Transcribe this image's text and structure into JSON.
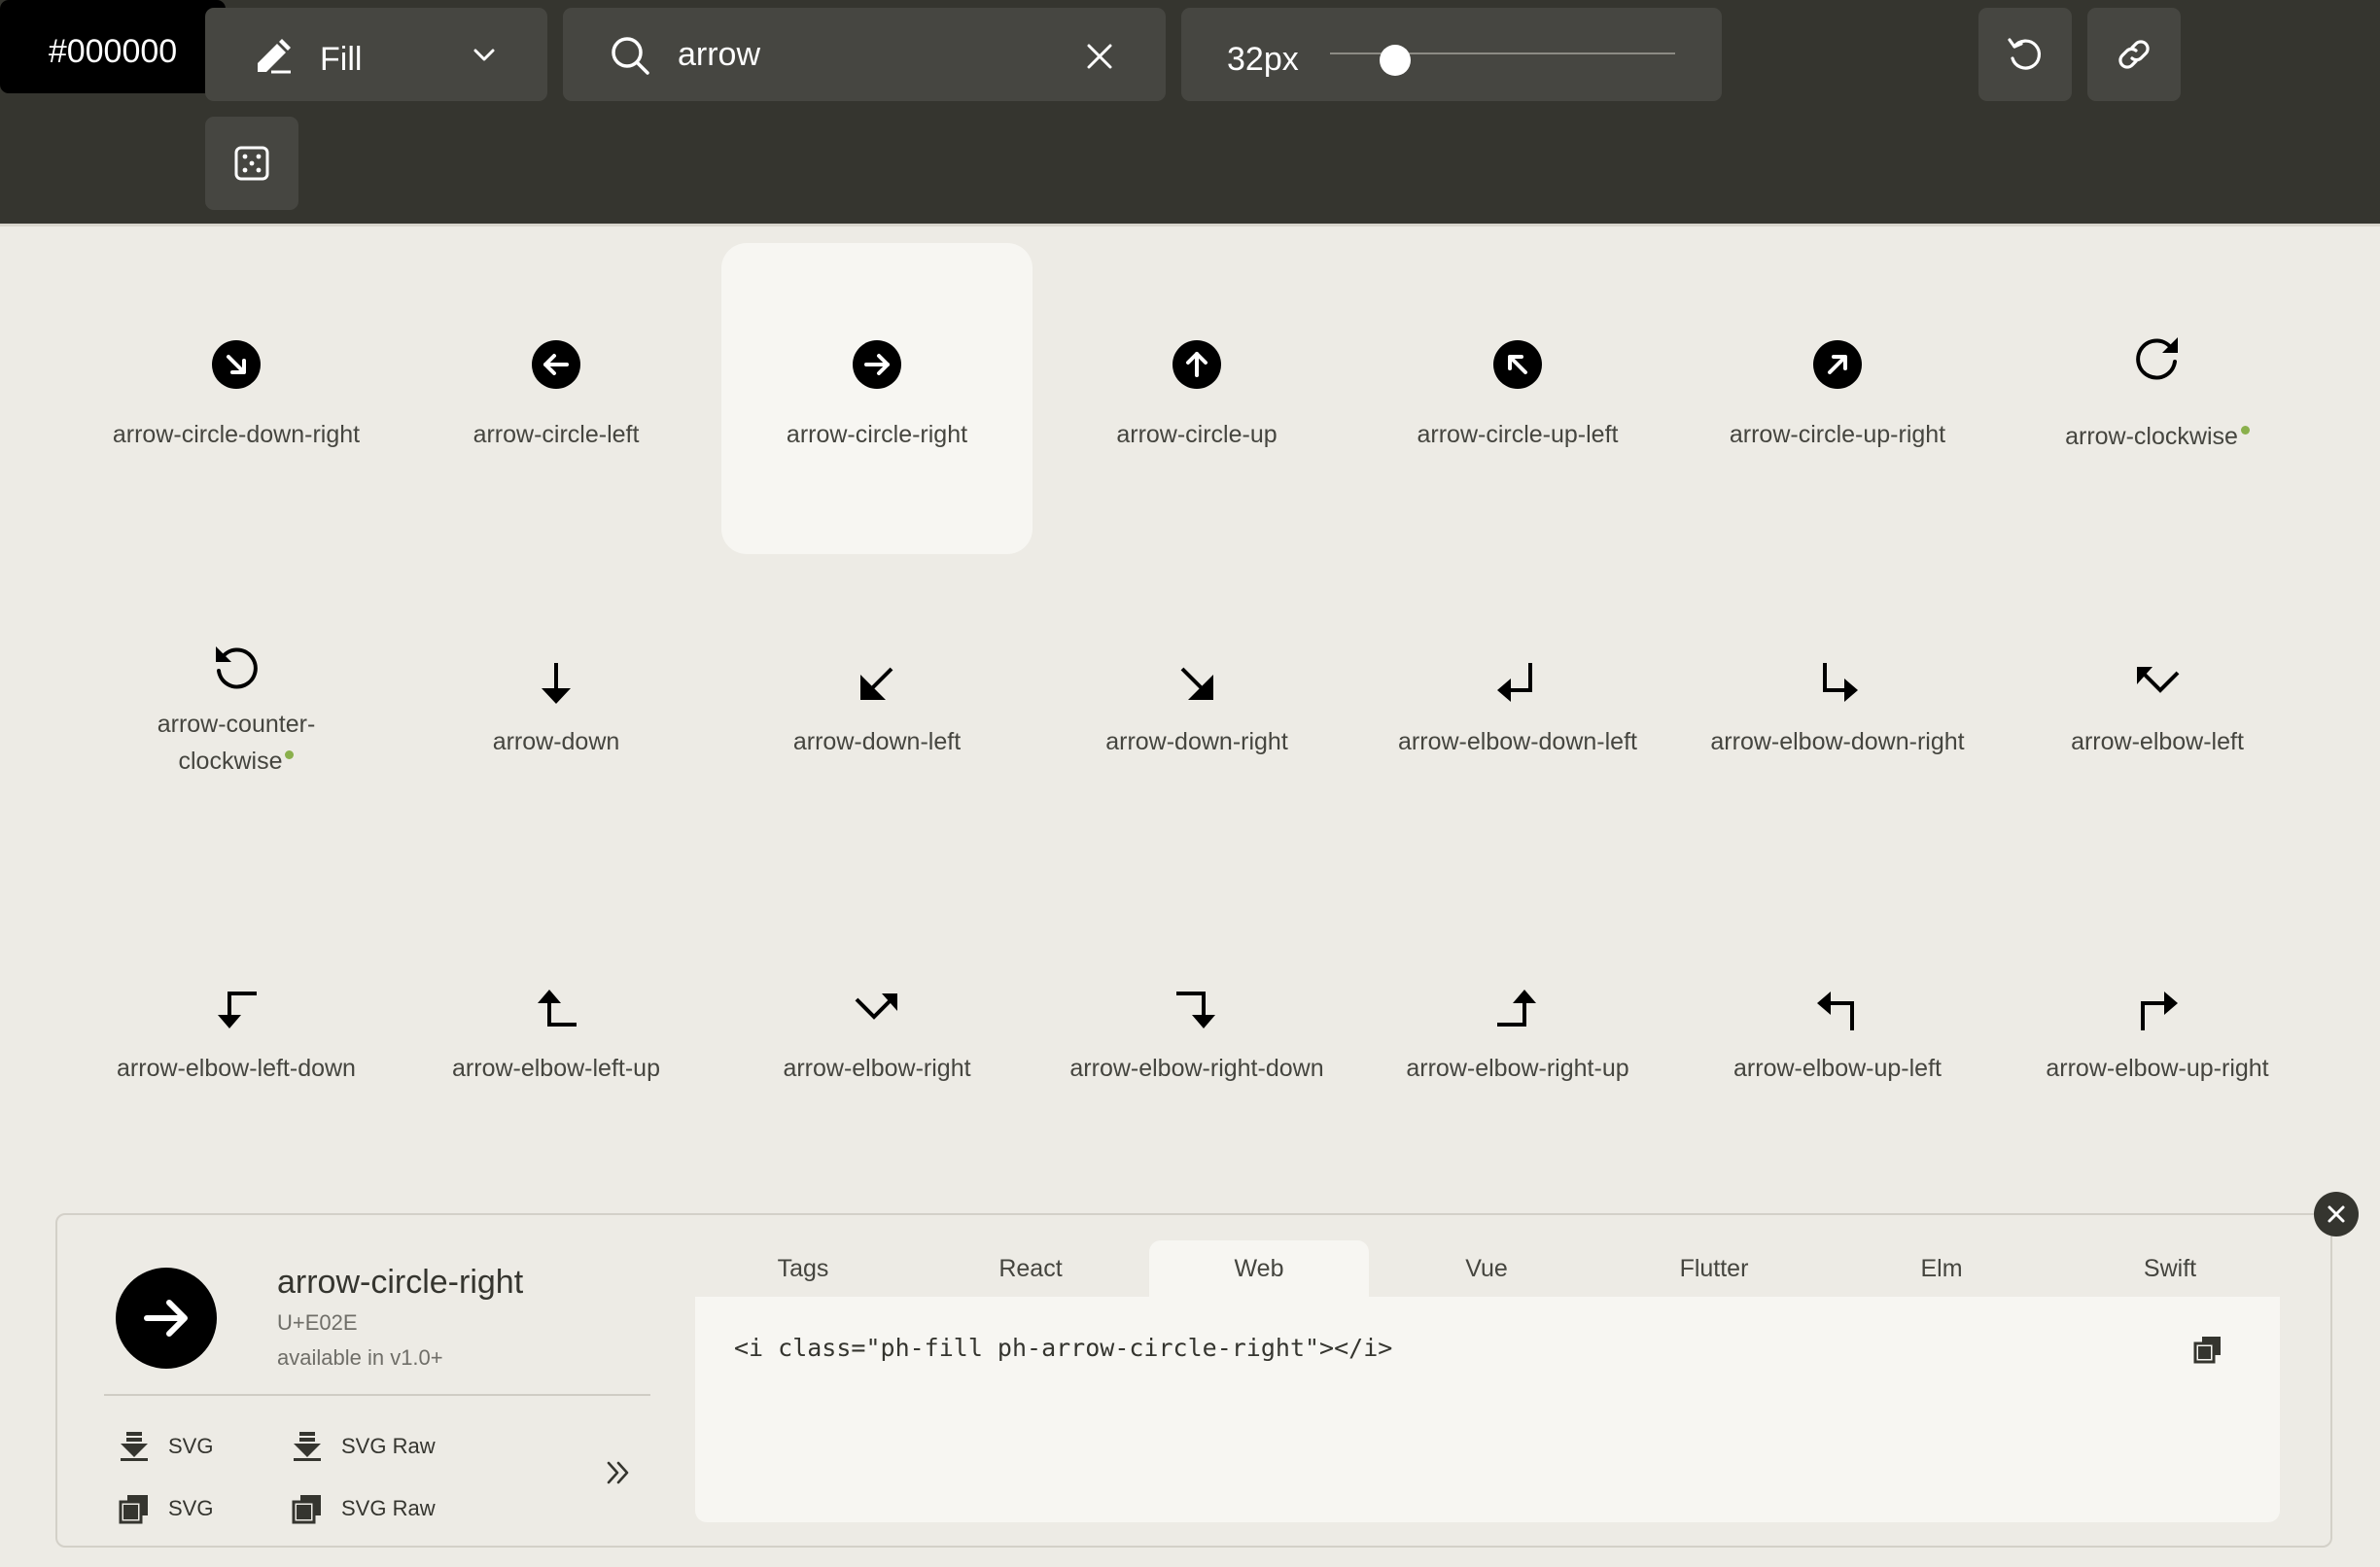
{
  "toolbar": {
    "weight_label": "Fill",
    "search_value": "arrow",
    "size_label": "32px",
    "size_slider": {
      "min": 16,
      "max": 96,
      "value": 32
    },
    "color_label": "#000000"
  },
  "icons": [
    {
      "name": "arrow-circle-down-right",
      "new": false
    },
    {
      "name": "arrow-circle-left",
      "new": false
    },
    {
      "name": "arrow-circle-right",
      "new": false,
      "selected": true
    },
    {
      "name": "arrow-circle-up",
      "new": false
    },
    {
      "name": "arrow-circle-up-left",
      "new": false
    },
    {
      "name": "arrow-circle-up-right",
      "new": false
    },
    {
      "name": "arrow-clockwise",
      "new": true
    },
    {
      "name": "arrow-counter-clockwise",
      "new": true
    },
    {
      "name": "arrow-down",
      "new": false
    },
    {
      "name": "arrow-down-left",
      "new": false
    },
    {
      "name": "arrow-down-right",
      "new": false
    },
    {
      "name": "arrow-elbow-down-left",
      "new": false
    },
    {
      "name": "arrow-elbow-down-right",
      "new": false
    },
    {
      "name": "arrow-elbow-left",
      "new": false
    },
    {
      "name": "arrow-elbow-left-down",
      "new": false
    },
    {
      "name": "arrow-elbow-left-up",
      "new": false
    },
    {
      "name": "arrow-elbow-right",
      "new": false
    },
    {
      "name": "arrow-elbow-right-down",
      "new": false
    },
    {
      "name": "arrow-elbow-right-up",
      "new": false
    },
    {
      "name": "arrow-elbow-up-left",
      "new": false
    },
    {
      "name": "arrow-elbow-up-right",
      "new": false
    }
  ],
  "details": {
    "name": "arrow-circle-right",
    "codepoint": "U+E02E",
    "version": "available in v1.0+",
    "downloads": {
      "svg_download": "SVG",
      "svg_raw_download": "SVG Raw",
      "svg_copy": "SVG",
      "svg_raw_copy": "SVG Raw"
    },
    "tabs": [
      "Tags",
      "React",
      "Web",
      "Vue",
      "Flutter",
      "Elm",
      "Swift"
    ],
    "active_tab": "Web",
    "code": "<i class=\"ph-fill ph-arrow-circle-right\"></i>"
  },
  "colors": {
    "toolbar_bg": "#35352f",
    "page_bg": "#edebe5",
    "accent_new_dot": "#8ab04c"
  }
}
